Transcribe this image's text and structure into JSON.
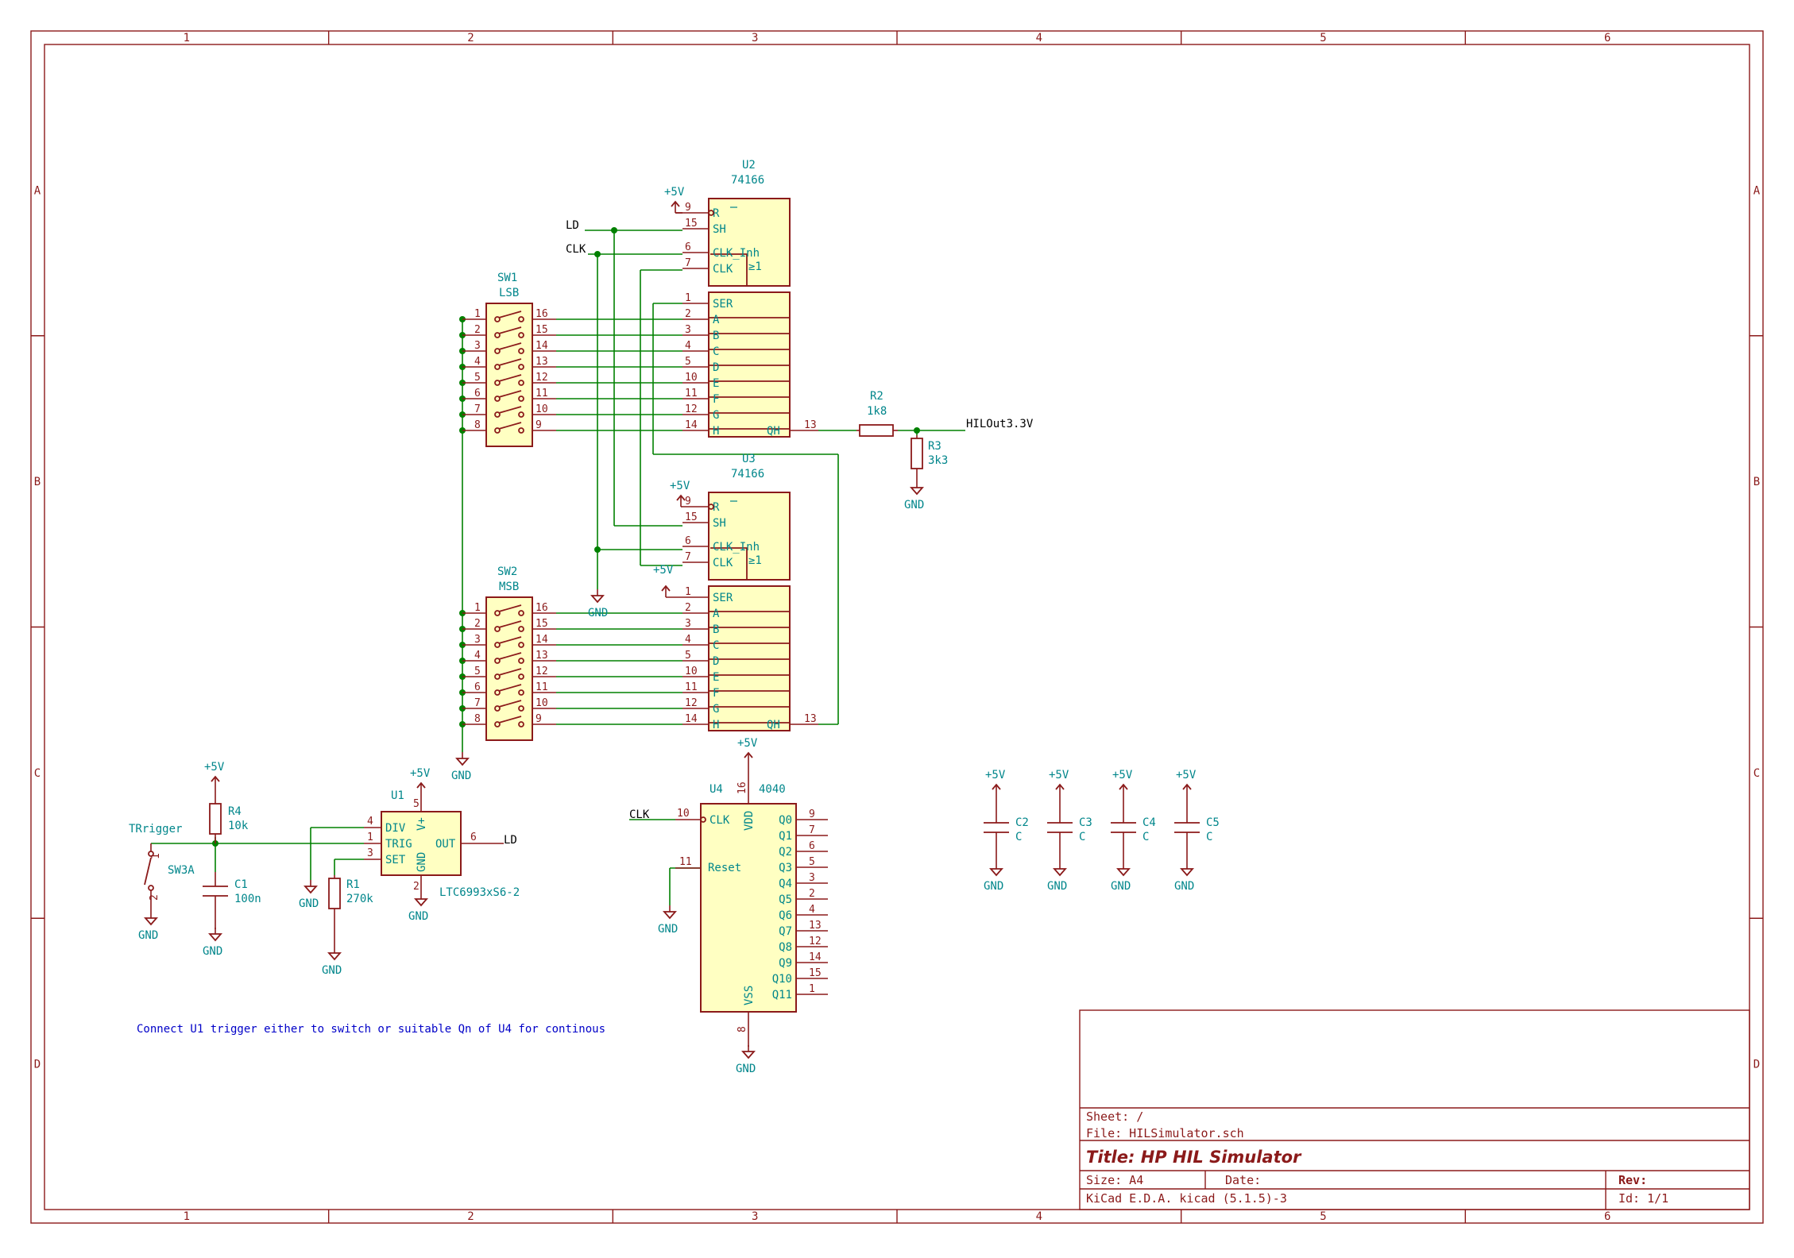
{
  "frame": {
    "columns": [
      "1",
      "2",
      "3",
      "4",
      "5",
      "6"
    ],
    "rows": [
      "A",
      "B",
      "C",
      "D"
    ]
  },
  "title_block": {
    "sheet": "Sheet: /",
    "file": "File: HILSimulator.sch",
    "title": "Title: HP HIL Simulator",
    "size": "Size: A4",
    "date": "Date:",
    "rev": "Rev:",
    "tool": "KiCad E.D.A.  kicad (5.1.5)-3",
    "id": "Id: 1/1"
  },
  "note": "Connect U1 trigger either to switch or suitable Qn of U4 for continous",
  "nets": {
    "ld": "LD",
    "clk": "CLK",
    "hil_out": "HILOut3.3V",
    "gnd": "GND",
    "vcc": "+5V"
  },
  "shift_register_pins": {
    "top": [
      {
        "num": "9",
        "name": "R"
      },
      {
        "num": "15",
        "name": "SH"
      },
      {
        "num": "6",
        "name": "CLK_Inh"
      },
      {
        "num": "7",
        "name": "CLK"
      }
    ],
    "sub_label": "≥1",
    "data": [
      {
        "num": "1",
        "name": "SER"
      },
      {
        "num": "2",
        "name": "A"
      },
      {
        "num": "3",
        "name": "B"
      },
      {
        "num": "4",
        "name": "C"
      },
      {
        "num": "5",
        "name": "D"
      },
      {
        "num": "10",
        "name": "E"
      },
      {
        "num": "11",
        "name": "F"
      },
      {
        "num": "12",
        "name": "G"
      },
      {
        "num": "14",
        "name": "H"
      }
    ],
    "out": {
      "num": "13",
      "name": "QH"
    }
  },
  "u2": {
    "ref": "U2",
    "value": "74166"
  },
  "u3": {
    "ref": "U3",
    "value": "74166"
  },
  "sw1": {
    "ref": "SW1",
    "value": "LSB"
  },
  "sw2": {
    "ref": "SW2",
    "value": "MSB"
  },
  "dip_left_pins": [
    "1",
    "2",
    "3",
    "4",
    "5",
    "6",
    "7",
    "8"
  ],
  "dip_right_pins": [
    "16",
    "15",
    "14",
    "13",
    "12",
    "11",
    "10",
    "9"
  ],
  "r2": {
    "ref": "R2",
    "value": "1k8"
  },
  "r3": {
    "ref": "R3",
    "value": "3k3"
  },
  "r4": {
    "ref": "R4",
    "value": "10k"
  },
  "r1": {
    "ref": "R1",
    "value": "270k"
  },
  "c1": {
    "ref": "C1",
    "value": "100n"
  },
  "sw3": {
    "ref": "SW3A",
    "label": "TRrigger",
    "pin1": "1",
    "pin2": "2"
  },
  "u1": {
    "ref": "U1",
    "value": "LTC6993xS6-2",
    "pins": [
      {
        "num": "4",
        "name": "DIV"
      },
      {
        "num": "1",
        "name": "TRIG"
      },
      {
        "num": "3",
        "name": "SET"
      },
      {
        "num": "6",
        "name": "OUT"
      },
      {
        "num": "5",
        "name": "V+"
      },
      {
        "num": "2",
        "name": "GND"
      }
    ]
  },
  "u4": {
    "ref": "U4",
    "value": "4040",
    "left": [
      {
        "num": "10",
        "name": "CLK"
      },
      {
        "num": "11",
        "name": "Reset"
      }
    ],
    "vdd": {
      "num": "16",
      "name": "VDD"
    },
    "vss": {
      "num": "8",
      "name": "VSS"
    },
    "outputs": [
      {
        "num": "9",
        "name": "Q0"
      },
      {
        "num": "7",
        "name": "Q1"
      },
      {
        "num": "6",
        "name": "Q2"
      },
      {
        "num": "5",
        "name": "Q3"
      },
      {
        "num": "3",
        "name": "Q4"
      },
      {
        "num": "2",
        "name": "Q5"
      },
      {
        "num": "4",
        "name": "Q6"
      },
      {
        "num": "13",
        "name": "Q7"
      },
      {
        "num": "12",
        "name": "Q8"
      },
      {
        "num": "14",
        "name": "Q9"
      },
      {
        "num": "15",
        "name": "Q10"
      },
      {
        "num": "1",
        "name": "Q11"
      }
    ]
  },
  "decoupling": [
    {
      "ref": "C2",
      "value": "C"
    },
    {
      "ref": "C3",
      "value": "C"
    },
    {
      "ref": "C4",
      "value": "C"
    },
    {
      "ref": "C5",
      "value": "C"
    }
  ]
}
